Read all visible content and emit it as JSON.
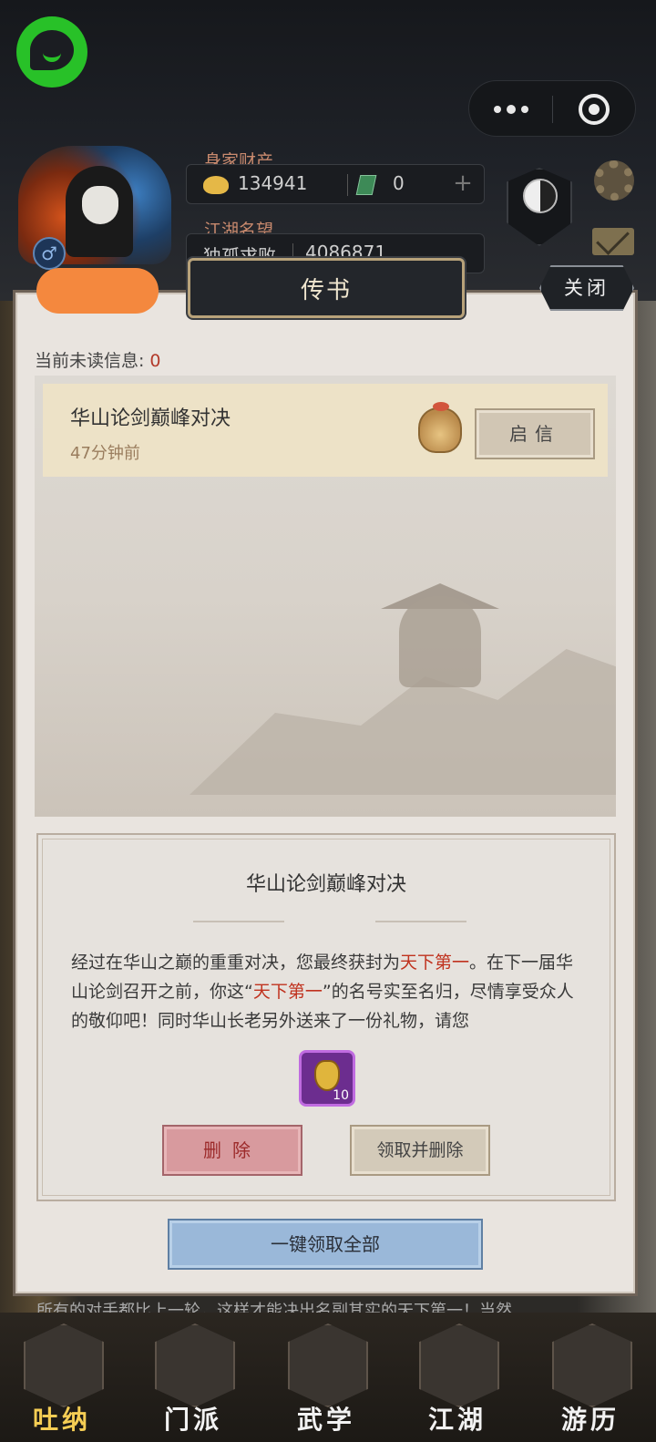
{
  "header": {
    "assets_label": "身家财产",
    "coins": "134941",
    "jade": "0",
    "plus": "+",
    "reputation_label": "江湖名望",
    "reputation_title": "独孤求败",
    "reputation_value": "4086871",
    "gender_symbol": "♂"
  },
  "modal": {
    "title": "传书",
    "close_label": "关闭",
    "unread_label": "当前未读信息:",
    "unread_count": "0",
    "mails": [
      {
        "subject": "华山论剑巅峰对决",
        "time": "47分钟前",
        "open_label": "启信"
      }
    ],
    "detail": {
      "title": "华山论剑巅峰对决",
      "body_1": "经过在华山之巅的重重对决，您最终获封为",
      "highlight_1": "天下第一",
      "body_2": "。在下一届华山论剑召开之前，你这“",
      "highlight_2": "天下第一",
      "body_3": "”的名号实至名归，尽情享受众人的敬仰吧！同时华山长老另外送来了一份礼物，请您",
      "item_qty": "10",
      "delete_label": "删除",
      "claim_delete_label": "领取并删除"
    },
    "claim_all_label": "一键领取全部"
  },
  "ticker": "所有的对手都比上一轮，这样才能决出名副其实的天下第一！当然",
  "nav": [
    {
      "label": "吐纳",
      "icon": "gourd-icon",
      "active": true
    },
    {
      "label": "门派",
      "icon": "sect-icon",
      "active": false
    },
    {
      "label": "武学",
      "icon": "scroll-icon",
      "active": false
    },
    {
      "label": "江湖",
      "icon": "hat-icon",
      "active": false
    },
    {
      "label": "游历",
      "icon": "horse-icon",
      "active": false
    }
  ],
  "colors": {
    "highlight": "#c0321e",
    "accent_gold": "#f5cd54",
    "wechat_green": "#28c128"
  }
}
